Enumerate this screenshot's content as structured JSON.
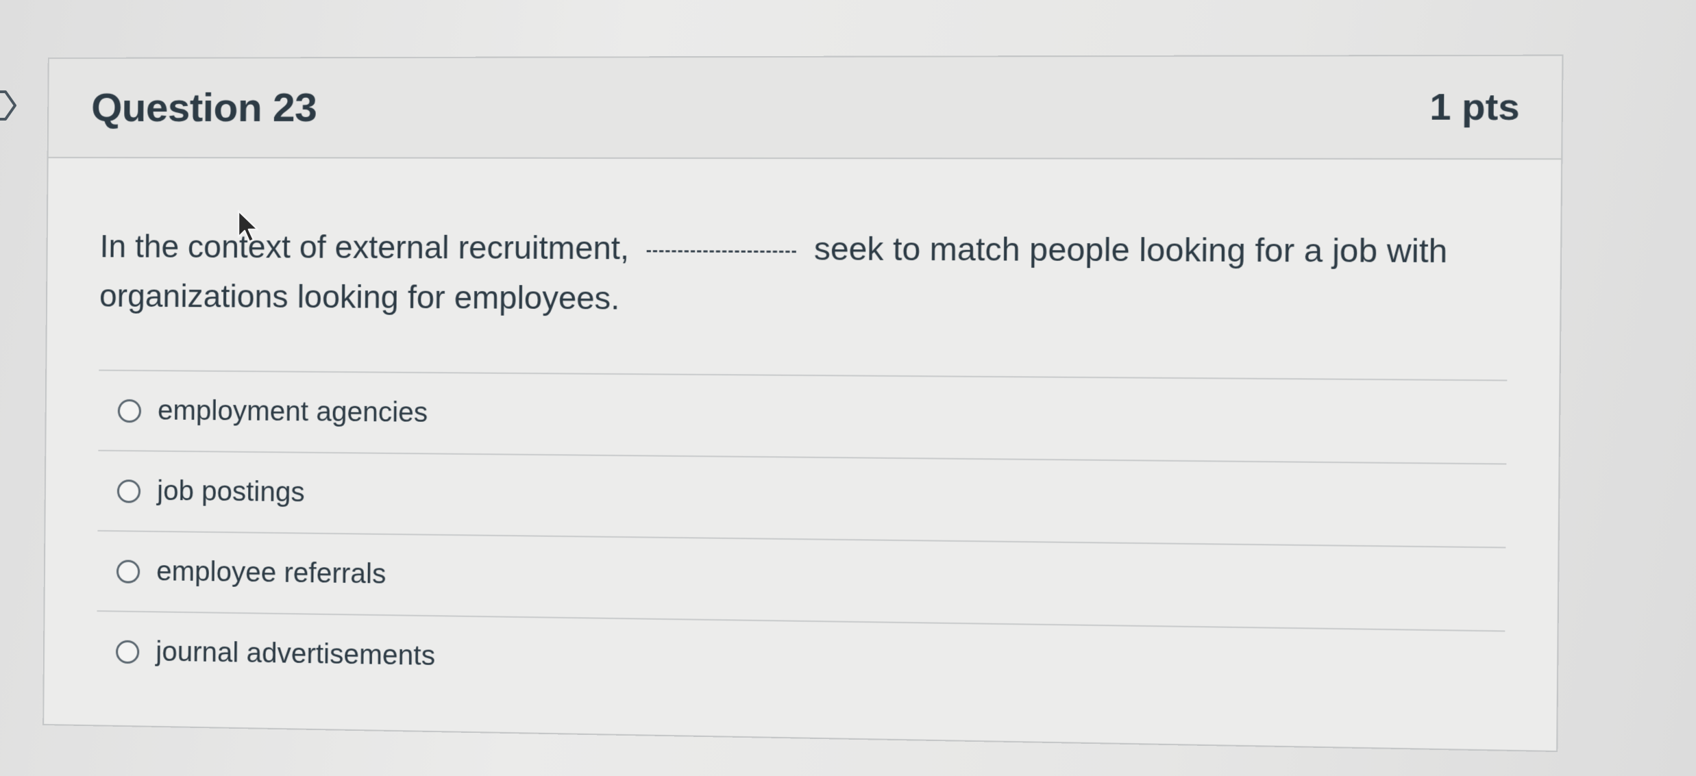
{
  "question": {
    "title": "Question 23",
    "points": "1 pts",
    "text_before_blank": "In the context of external recruitment, ",
    "text_after_blank": " seek to match people looking for a job with organizations looking for employees."
  },
  "answers": [
    {
      "label": "employment agencies"
    },
    {
      "label": "job postings"
    },
    {
      "label": "employee referrals"
    },
    {
      "label": "journal advertisements"
    }
  ],
  "icons": {
    "flag": "flag-outline-icon",
    "cursor": "mouse-pointer-icon"
  },
  "colors": {
    "text": "#2d3b45",
    "border": "#c4c6c7",
    "header_bg": "#e5e5e4",
    "card_bg": "#ececeb"
  }
}
